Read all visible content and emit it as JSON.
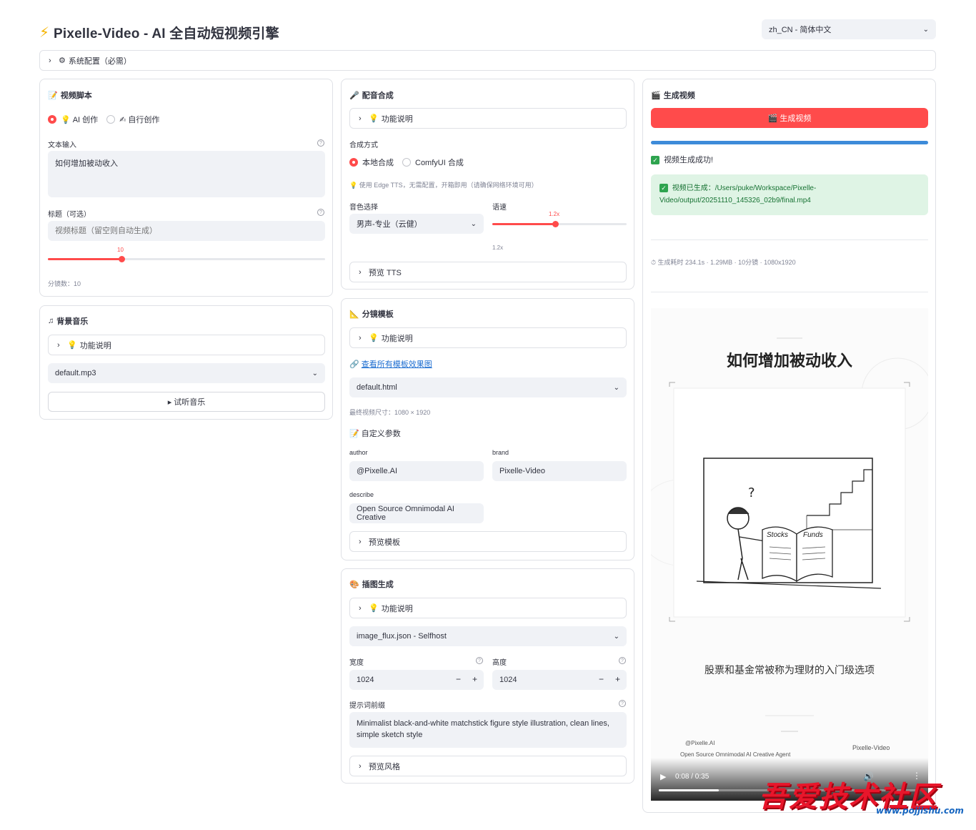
{
  "header": {
    "title": "Pixelle-Video - AI 全自动短视频引擎",
    "language": "zh_CN - 简体中文"
  },
  "system_config": {
    "label": "系统配置（必需）"
  },
  "script_card": {
    "title": "视频脚本",
    "mode_ai": "AI 创作",
    "mode_self": "自行创作",
    "text_label": "文本输入",
    "text_value": "如何增加被动收入",
    "title_label": "标题（可选）",
    "title_placeholder": "视频标题（留空则自动生成）",
    "slider_value": "10",
    "slider_fraction": 0.265,
    "shots_text": "分镜数：10"
  },
  "bgm_card": {
    "title": "背景音乐",
    "help_label": "功能说明",
    "selected": "default.mp3",
    "preview_button": "▸ 试听音乐"
  },
  "tts_card": {
    "title": "配音合成",
    "help_label": "功能说明",
    "method_label": "合成方式",
    "method_local": "本地合成",
    "method_comfy": "ComfyUI 合成",
    "note": "使用 Edge TTS，无需配置，开箱即用（请确保网络环境可用）",
    "voice_label": "音色选择",
    "voice_value": "男声-专业（云健）",
    "speed_label": "语速",
    "speed_value": "1.2x",
    "speed_fraction": 0.47,
    "speed_caption": "1.2x",
    "preview_label": "预览 TTS"
  },
  "template_card": {
    "title": "分镜模板",
    "help_label": "功能说明",
    "link": "查看所有模板效果图",
    "selected": "default.html",
    "size_text": "最终视频尺寸：1080 × 1920",
    "custom_title": "自定义参数",
    "author_label": "author",
    "author_value": "@Pixelle.AI",
    "brand_label": "brand",
    "brand_value": "Pixelle-Video",
    "describe_label": "describe",
    "describe_value": "Open Source Omnimodal AI Creative",
    "preview_label": "预览模板"
  },
  "image_card": {
    "title": "插图生成",
    "help_label": "功能说明",
    "workflow": "image_flux.json - Selfhost",
    "width_label": "宽度",
    "width_value": "1024",
    "height_label": "高度",
    "height_value": "1024",
    "prompt_label": "提示词前缀",
    "prompt_value": "Minimalist black-and-white matchstick figure style illustration, clean lines, simple sketch style",
    "preview_label": "预览风格"
  },
  "generate_card": {
    "title": "生成视频",
    "button": "🎬 生成视频",
    "progress": 1.0,
    "success_text": "视频生成成功!",
    "saved_text": "视频已生成：/Users/puke/Workspace/Pixelle-Video/output/20251110_145326_02b9/final.mp4",
    "stats": "生成耗时 234.1s  ·  1.29MB  ·  10分镜  ·  1080x1920"
  },
  "video": {
    "title": "如何增加被动收入",
    "subtitle": "股票和基金常被称为理财的入门级选项",
    "book_left": "Stocks",
    "book_right": "Funds",
    "footer_author": "@Pixelle.AI",
    "footer_desc": "Open Source Omnimodal AI Creative Agent",
    "footer_brand": "Pixelle-Video",
    "time": "0:08 / 0:35",
    "playback_fraction": 0.23
  },
  "watermark": {
    "text": "吾爱技术社区",
    "url": "www.pojjishu.com"
  },
  "colors": {
    "accent": "#ff4b4b",
    "success": "#2ea44f",
    "progress": "#3d8bd9"
  }
}
